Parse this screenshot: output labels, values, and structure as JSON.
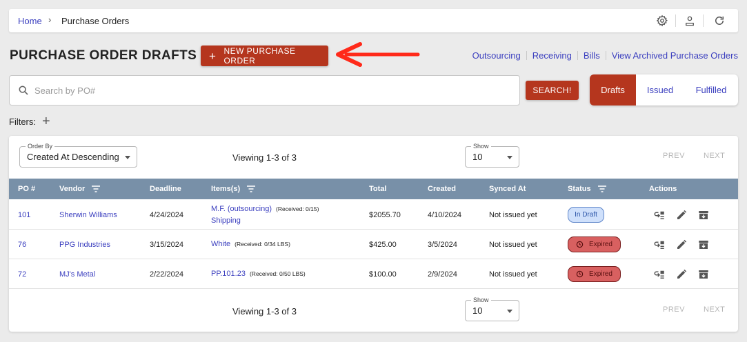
{
  "breadcrumb": {
    "home": "Home",
    "separator": "›",
    "current": "Purchase Orders"
  },
  "topbar_icons": [
    "gear-icon",
    "user-upload-icon",
    "refresh-icon"
  ],
  "page": {
    "title": "PURCHASE ORDER DRAFTS",
    "new_po_label": "NEW PURCHASE ORDER",
    "plus": "+"
  },
  "top_links": [
    "Outsourcing",
    "Receiving",
    "Bills",
    "View Archived Purchase Orders"
  ],
  "search": {
    "placeholder": "Search by PO#",
    "value": "",
    "button": "SEARCH!"
  },
  "tabs": [
    {
      "label": "Drafts",
      "active": true
    },
    {
      "label": "Issued",
      "active": false
    },
    {
      "label": "Fulfilled",
      "active": false
    }
  ],
  "filters": {
    "label": "Filters:",
    "add": "+"
  },
  "order_by": {
    "label": "Order By",
    "value": "Created At Descending"
  },
  "show": {
    "label": "Show",
    "value": "10"
  },
  "viewing": "Viewing 1-3 of 3",
  "pager": {
    "prev": "PREV",
    "next": "NEXT"
  },
  "columns": [
    "PO #",
    "Vendor",
    "Deadline",
    "Items(s)",
    "Total",
    "Created",
    "Synced At",
    "Status",
    "Actions"
  ],
  "rows": [
    {
      "po": "101",
      "vendor": "Sherwin Williams",
      "deadline": "4/24/2024",
      "item": "M.F. (outsourcing)",
      "received": "(Received: 0/15)",
      "item2": "Shipping",
      "total": "$2055.70",
      "created": "4/10/2024",
      "synced": "Not issued yet",
      "status": "In Draft"
    },
    {
      "po": "76",
      "vendor": "PPG Industries",
      "deadline": "3/15/2024",
      "item": "White",
      "received": "(Received: 0/34 LBS)",
      "total": "$425.00",
      "created": "3/5/2024",
      "synced": "Not issued yet",
      "status": "Expired"
    },
    {
      "po": "72",
      "vendor": "MJ's Metal",
      "deadline": "2/22/2024",
      "item": "PP.101.23",
      "received": "(Received: 0/50 LBS)",
      "total": "$100.00",
      "created": "2/9/2024",
      "synced": "Not issued yet",
      "status": "Expired"
    }
  ],
  "colors": {
    "accent": "#b5361e",
    "link": "#3b3fbf",
    "header": "#7890a8",
    "annotation_arrow": "#ff2a1a"
  }
}
